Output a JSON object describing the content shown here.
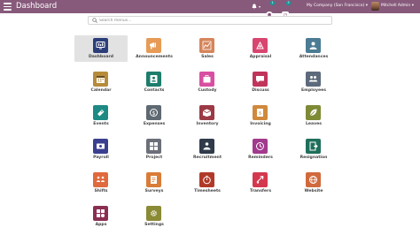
{
  "header": {
    "title": "Dashboard",
    "company": "My Company (San Francisco)",
    "user": "Mitchell Admin",
    "chat_count": "1",
    "activity_count": "3"
  },
  "search": {
    "placeholder": "Search menus..."
  },
  "colors": {
    "topbar": "#875a7b",
    "active_tile": "#e2e2e2"
  },
  "apps": [
    {
      "label": "Dashboard",
      "icon": "dashboard-icon",
      "color": "#2c3e7a",
      "active": true
    },
    {
      "label": "Announcements",
      "icon": "announcements-icon",
      "color": "#e79b56"
    },
    {
      "label": "Sales",
      "icon": "sales-icon",
      "color": "#d6855b"
    },
    {
      "label": "Appraisal",
      "icon": "appraisal-icon",
      "color": "#d8456f"
    },
    {
      "label": "Attendances",
      "icon": "attendances-icon",
      "color": "#4c7b94"
    },
    {
      "label": "Calendar",
      "icon": "calendar-icon",
      "color": "#b68b3a"
    },
    {
      "label": "Contacts",
      "icon": "contacts-icon",
      "color": "#1e7d6c"
    },
    {
      "label": "Custody",
      "icon": "custody-icon",
      "color": "#d84ea0"
    },
    {
      "label": "Discuss",
      "icon": "discuss-icon",
      "color": "#c0345a"
    },
    {
      "label": "Employees",
      "icon": "employees-icon",
      "color": "#5c6a7c"
    },
    {
      "label": "Events",
      "icon": "events-icon",
      "color": "#1d8a84"
    },
    {
      "label": "Expenses",
      "icon": "expenses-icon",
      "color": "#5e6972"
    },
    {
      "label": "Inventory",
      "icon": "inventory-icon",
      "color": "#9b3a45"
    },
    {
      "label": "Invoicing",
      "icon": "invoicing-icon",
      "color": "#d0893c"
    },
    {
      "label": "Leaves",
      "icon": "leaves-icon",
      "color": "#7f8a35"
    },
    {
      "label": "Payroll",
      "icon": "payroll-icon",
      "color": "#3b3f8f"
    },
    {
      "label": "Project",
      "icon": "project-icon",
      "color": "#6b6f78"
    },
    {
      "label": "Recruitment",
      "icon": "recruitment-icon",
      "color": "#2f3a4a"
    },
    {
      "label": "Reminders",
      "icon": "reminders-icon",
      "color": "#a23a8d"
    },
    {
      "label": "Resignation",
      "icon": "resignation-icon",
      "color": "#1f6f5b"
    },
    {
      "label": "Shifts",
      "icon": "shifts-icon",
      "color": "#e06a3e"
    },
    {
      "label": "Surveys",
      "icon": "surveys-icon",
      "color": "#d97c38"
    },
    {
      "label": "Timesheets",
      "icon": "timesheets-icon",
      "color": "#b03a28"
    },
    {
      "label": "Transfers",
      "icon": "transfers-icon",
      "color": "#d4384e"
    },
    {
      "label": "Website",
      "icon": "website-icon",
      "color": "#d06a3d"
    },
    {
      "label": "Apps",
      "icon": "apps-icon",
      "color": "#8a2f52"
    },
    {
      "label": "Settings",
      "icon": "settings-icon",
      "color": "#8b8a35"
    }
  ]
}
